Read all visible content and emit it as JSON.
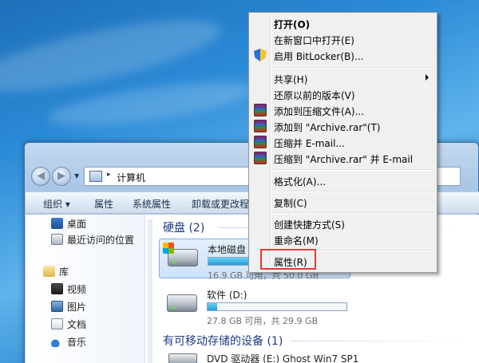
{
  "context_menu": {
    "items": [
      {
        "label": "打开(O)",
        "bold": true,
        "icon": ""
      },
      {
        "label": "在新窗口中打开(E)",
        "icon": ""
      },
      {
        "label": "启用 BitLocker(B)...",
        "icon": "shield-icon"
      },
      {
        "label": "共享(H)",
        "icon": "",
        "submenu": true
      },
      {
        "label": "还原以前的版本(V)",
        "icon": ""
      },
      {
        "label": "添加到压缩文件(A)...",
        "icon": "winrar-icon"
      },
      {
        "label": "添加到 \"Archive.rar\"(T)",
        "icon": "winrar-icon"
      },
      {
        "label": "压缩并 E-mail...",
        "icon": "winrar-icon"
      },
      {
        "label": "压缩到 \"Archive.rar\" 并 E-mail",
        "icon": "winrar-icon"
      },
      {
        "label": "格式化(A)...",
        "icon": ""
      },
      {
        "label": "复制(C)",
        "icon": ""
      },
      {
        "label": "创建快捷方式(S)",
        "icon": ""
      },
      {
        "label": "重命名(M)",
        "icon": ""
      },
      {
        "label": "属性(R)",
        "icon": "",
        "highlighted": true
      }
    ],
    "highlight_color": "#e23b3b"
  },
  "address_bar": {
    "path": "计算机"
  },
  "toolbar": {
    "organize": "组织 ▾",
    "properties": "属性",
    "system_properties": "系统属性",
    "uninstall": "卸载或更改程序"
  },
  "sidebar": {
    "items": [
      {
        "label": "桌面",
        "icon": "desktop-icon"
      },
      {
        "label": "最近访问的位置",
        "icon": "recent-places-icon"
      },
      {
        "label": "库",
        "icon": "library-icon"
      },
      {
        "label": "视频",
        "icon": "video-icon"
      },
      {
        "label": "图片",
        "icon": "pictures-icon"
      },
      {
        "label": "文档",
        "icon": "documents-icon"
      },
      {
        "label": "音乐",
        "icon": "music-icon"
      }
    ]
  },
  "content": {
    "hard_disks_title": "硬盘 (2)",
    "removable_title": "有可移动存储的设备 (1)",
    "drives": [
      {
        "name": "本地磁盘 (C",
        "info": "16.9 GB 可用，共 50.0 GB",
        "used_fraction": 0.66,
        "selected": true
      },
      {
        "name": "软件 (D:)",
        "info": "27.8 GB 可用，共 29.9 GB",
        "used_fraction": 0.07,
        "selected": false
      }
    ],
    "dvd": {
      "name": "DVD 驱动器 (E:) Ghost Win7 SP1"
    }
  }
}
